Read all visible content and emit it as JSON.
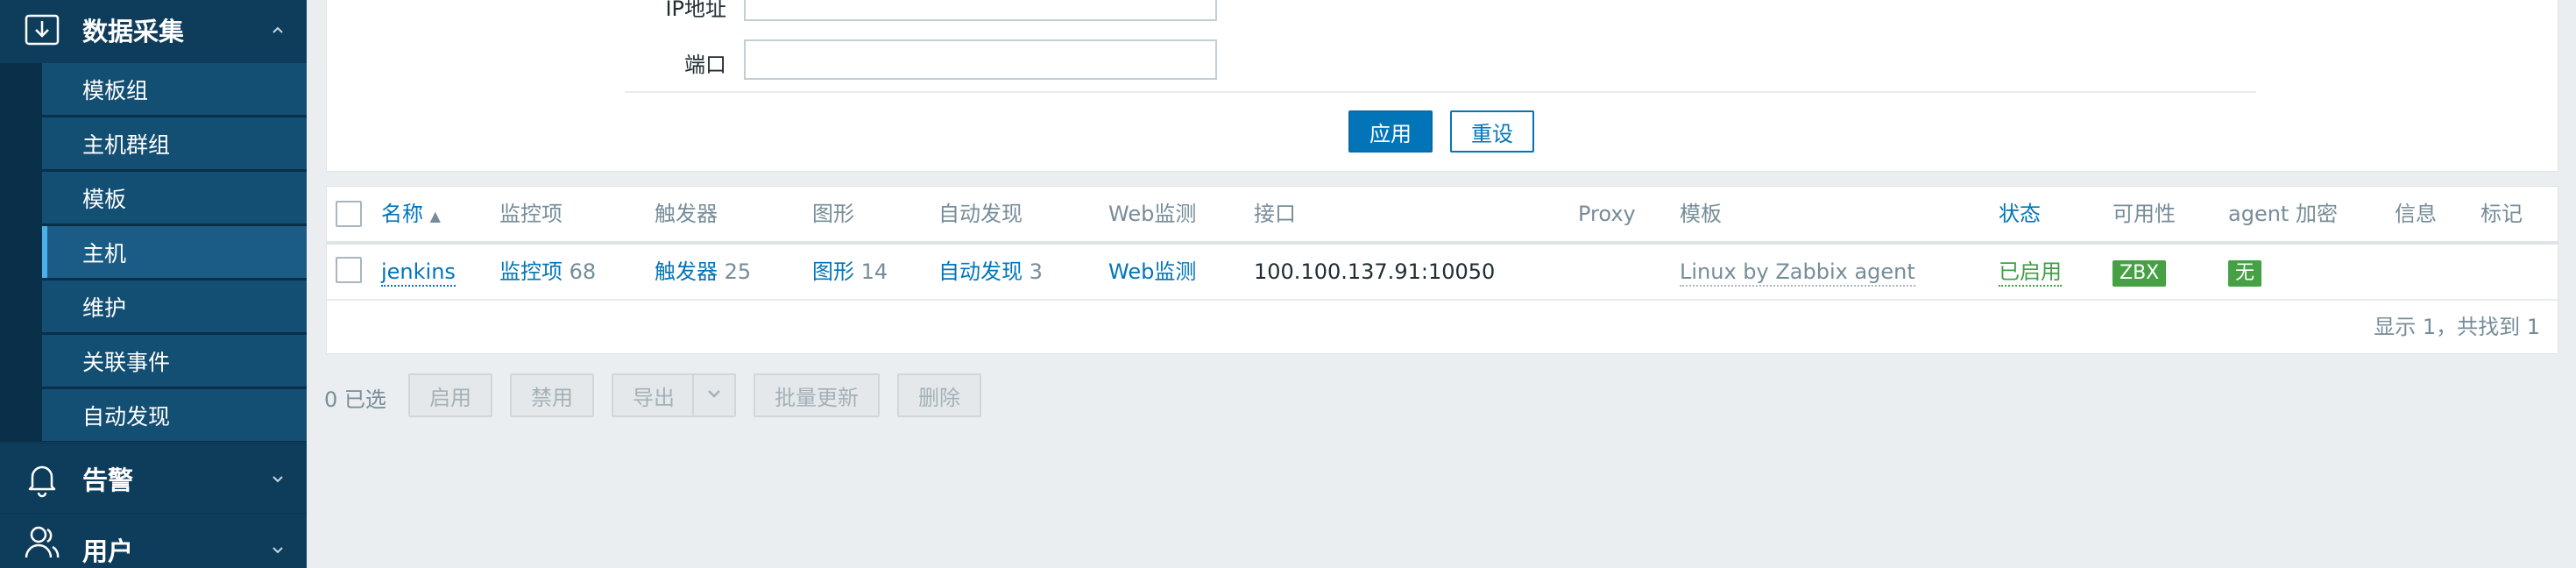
{
  "sidebar": {
    "collect": {
      "label": "数据采集",
      "icon": "download-box-icon"
    },
    "items": [
      {
        "label": "模板组"
      },
      {
        "label": "主机群组"
      },
      {
        "label": "模板"
      },
      {
        "label": "主机"
      },
      {
        "label": "维护"
      },
      {
        "label": "关联事件"
      },
      {
        "label": "自动发现"
      }
    ],
    "alarm": {
      "label": "告警",
      "icon": "bell-icon"
    },
    "user": {
      "label": "用户",
      "icon": "user-icon"
    }
  },
  "filter": {
    "ip_label": "IP地址",
    "ip_value": "",
    "port_label": "端口",
    "port_value": "",
    "apply_label": "应用",
    "reset_label": "重设"
  },
  "table": {
    "columns": {
      "name": "名称",
      "sort_indicator": "▲",
      "items": "监控项",
      "triggers": "触发器",
      "graphs": "图形",
      "discovery": "自动发现",
      "web": "Web监测",
      "interface": "接口",
      "proxy": "Proxy",
      "templates": "模板",
      "status": "状态",
      "availability": "可用性",
      "encryption": "agent 加密",
      "info": "信息",
      "tags": "标记"
    },
    "rows": [
      {
        "name": "jenkins",
        "items_label": "监控项",
        "items_count": "68",
        "triggers_label": "触发器",
        "triggers_count": "25",
        "graphs_label": "图形",
        "graphs_count": "14",
        "discovery_label": "自动发现",
        "discovery_count": "3",
        "web_label": "Web监测",
        "interface": "100.100.137.91:10050",
        "proxy": "",
        "template": "Linux by Zabbix agent",
        "status": "已启用",
        "availability": "ZBX",
        "encryption": "无"
      }
    ],
    "footer": "显示 1，共找到 1"
  },
  "actions": {
    "selected": "0 已选",
    "enable": "启用",
    "disable": "禁用",
    "export": "导出",
    "mass_update": "批量更新",
    "delete": "删除"
  },
  "colors": {
    "sidebar_bg": "#0e3d5c",
    "accent": "#0275b8",
    "status_green": "#429e47",
    "badge_green": "#46a044"
  }
}
